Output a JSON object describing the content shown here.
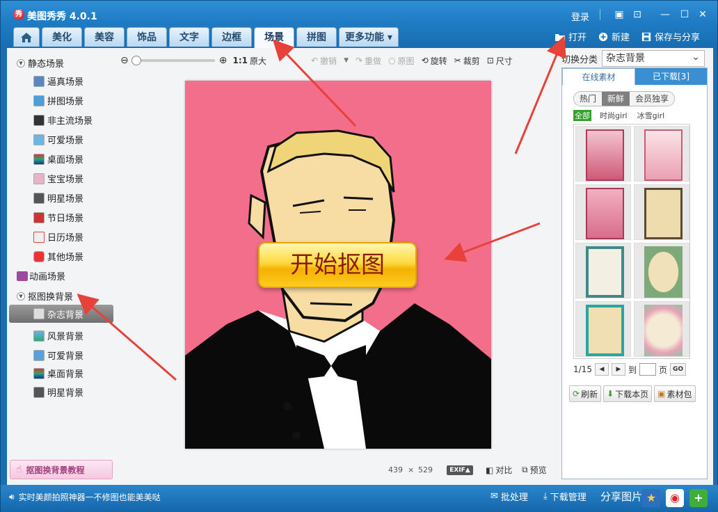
{
  "app": {
    "title": "美图秀秀 4.0.1",
    "logo_char": "秀",
    "login": "登录"
  },
  "tabs": [
    "美化",
    "美容",
    "饰品",
    "文字",
    "边框",
    "场景",
    "拼图",
    "更多功能 ▾"
  ],
  "active_tab": "场景",
  "top_actions": {
    "open": "打开",
    "new": "新建",
    "save_share": "保存与分享"
  },
  "toolbar": {
    "zoom_ratio": "1:1",
    "original_size": "原大",
    "undo": "撤销",
    "redo": "重做",
    "original": "原图",
    "rotate": "旋转",
    "crop": "裁剪",
    "resize": "尺寸"
  },
  "sidebar": {
    "static_group": "静态场景",
    "static_items": [
      "逼真场景",
      "拼图场景",
      "非主流场景",
      "可爱场景",
      "桌面场景",
      "宝宝场景",
      "明星场景",
      "节日场景",
      "日历场景",
      "其他场景"
    ],
    "anim_group": "动画场景",
    "cutout_group": "抠图换背景",
    "cutout_items": [
      "杂志背景",
      "风景背景",
      "可爱背景",
      "桌面背景",
      "明星背景"
    ],
    "selected_item": "杂志背景",
    "tutorial": "抠图换背景教程"
  },
  "canvas": {
    "start_cutout": "开始抠图",
    "width": "439",
    "times": "×",
    "height": "529",
    "exif": "EXIF▲",
    "compare": "对比",
    "preview": "预览"
  },
  "right_panel": {
    "switch_label": "切换分类",
    "category": "杂志背景",
    "tab_online": "在线素材",
    "tab_downloaded": "已下载[3]",
    "pills": [
      "热门",
      "新鲜",
      "会员独享"
    ],
    "active_pill": "新鲜",
    "filters": [
      "全部",
      "时尚girl",
      "冰雪girl"
    ],
    "active_filter": "全部",
    "page": "1/15",
    "to_label": "到",
    "page_label": "页",
    "go": "GO",
    "refresh": "刷新",
    "download_page": "下载本页",
    "material_pack": "素材包"
  },
  "status": {
    "text": "实时美颜拍照神器一不修图也能美美哒",
    "batch": "批处理",
    "download_mgr": "下载管理",
    "share_pics": "分享图片"
  },
  "colors": {
    "title_blue": "#1f7cc4",
    "canvas_pink": "#f36e8a",
    "annotation_red": "#e8413a",
    "button_yellow": "#ffd940"
  }
}
